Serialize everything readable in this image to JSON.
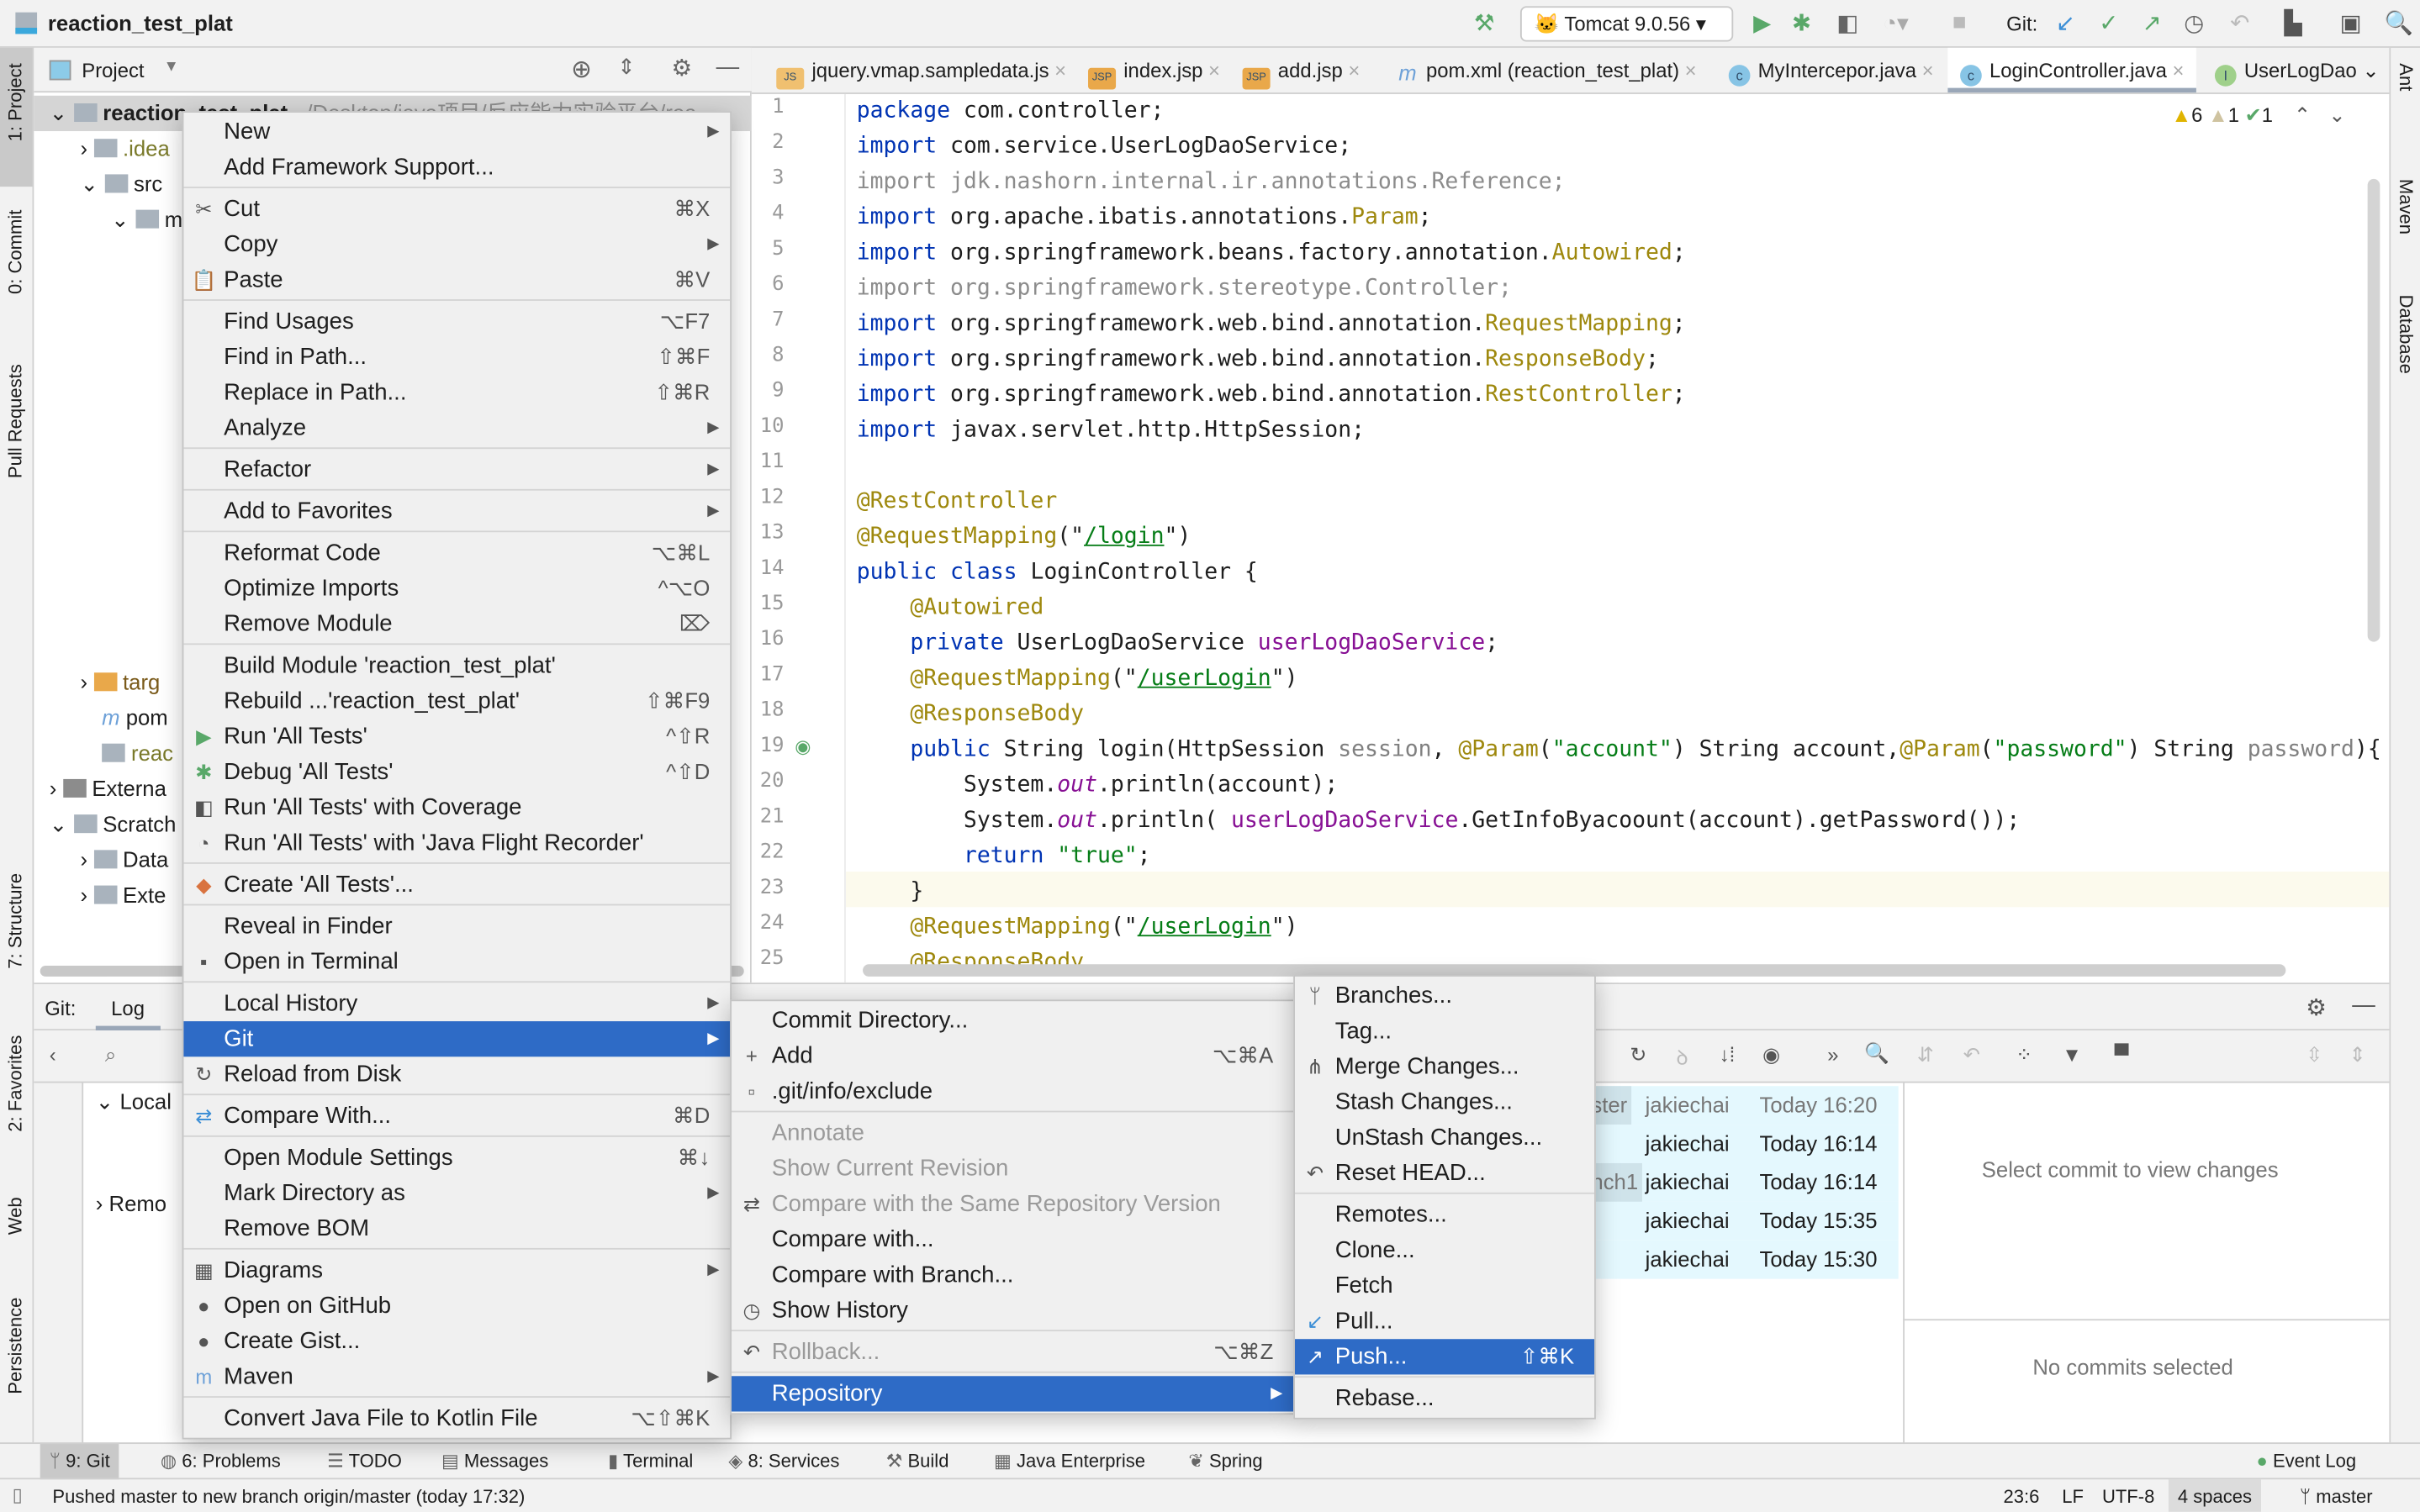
{
  "window": {
    "title": "reaction_test_plat"
  },
  "toolbar": {
    "run_config": "Tomcat 9.0.56",
    "git_label": "Git:"
  },
  "left_strip": [
    "1: Project",
    "0: Commit",
    "Pull Requests",
    "7: Structure",
    "2: Favorites",
    "Web",
    "Persistence"
  ],
  "right_strip": [
    "Ant",
    "Maven",
    "Database"
  ],
  "project": {
    "header": "Project",
    "root": "reaction_test_plat",
    "root_path": "~/Desktop/java项目/反应能力实验平台/rea",
    "tree": [
      ".idea",
      "src",
      "m",
      "targ",
      "pom",
      "reac",
      "Externa",
      "Scratch",
      "Data",
      "Exte"
    ]
  },
  "tabs": [
    {
      "label": "jquery.vmap.sampledata.js",
      "icon": "js"
    },
    {
      "label": "index.jsp",
      "icon": "jsp"
    },
    {
      "label": "add.jsp",
      "icon": "jsp"
    },
    {
      "label": "pom.xml (reaction_test_plat)",
      "icon": "m"
    },
    {
      "label": "MyIntercepor.java",
      "icon": "C"
    },
    {
      "label": "LoginController.java",
      "icon": "C",
      "active": true
    },
    {
      "label": "UserLogDao",
      "icon": "I"
    }
  ],
  "inspections": {
    "warnings": "6",
    "weak_warnings": "1",
    "ok": "1"
  },
  "code": [
    [
      [
        "package ",
        "k"
      ],
      [
        "com.controller;",
        ""
      ]
    ],
    [
      [
        "import ",
        "k"
      ],
      [
        "com.service.UserLogDaoService;",
        ""
      ]
    ],
    [
      [
        "import jdk.nashorn.internal.ir.annotations.Reference;",
        "g"
      ]
    ],
    [
      [
        "import ",
        "k"
      ],
      [
        "org.apache.ibatis.annotations.",
        ""
      ],
      [
        "Param",
        "a"
      ],
      [
        ";",
        ""
      ]
    ],
    [
      [
        "import ",
        "k"
      ],
      [
        "org.springframework.beans.factory.annotation.",
        ""
      ],
      [
        "Autowired",
        "a"
      ],
      [
        ";",
        ""
      ]
    ],
    [
      [
        "import org.springframework.stereotype.Controller;",
        "g"
      ]
    ],
    [
      [
        "import ",
        "k"
      ],
      [
        "org.springframework.web.bind.annotation.",
        ""
      ],
      [
        "RequestMapping",
        "a"
      ],
      [
        ";",
        ""
      ]
    ],
    [
      [
        "import ",
        "k"
      ],
      [
        "org.springframework.web.bind.annotation.",
        ""
      ],
      [
        "ResponseBody",
        "a"
      ],
      [
        ";",
        ""
      ]
    ],
    [
      [
        "import ",
        "k"
      ],
      [
        "org.springframework.web.bind.annotation.",
        ""
      ],
      [
        "RestController",
        "a"
      ],
      [
        ";",
        ""
      ]
    ],
    [
      [
        "import ",
        "k"
      ],
      [
        "javax.servlet.http.HttpSession;",
        ""
      ]
    ],
    [],
    [
      [
        "@RestController",
        "a"
      ]
    ],
    [
      [
        "@RequestMapping",
        "a"
      ],
      [
        "(\"",
        ""
      ],
      [
        "/login",
        "u"
      ],
      [
        "\")",
        ""
      ]
    ],
    [
      [
        "public class ",
        "k"
      ],
      [
        "LoginController {",
        ""
      ]
    ],
    [
      [
        "    ",
        ""
      ],
      [
        "@Autowired",
        "a"
      ]
    ],
    [
      [
        "    ",
        ""
      ],
      [
        "private ",
        "k"
      ],
      [
        "UserLogDaoService ",
        ""
      ],
      [
        "userLogDaoService",
        "f"
      ],
      [
        ";",
        ""
      ]
    ],
    [
      [
        "    ",
        ""
      ],
      [
        "@RequestMapping",
        "a"
      ],
      [
        "(\"",
        ""
      ],
      [
        "/userLogin",
        "u"
      ],
      [
        "\")",
        ""
      ]
    ],
    [
      [
        "    ",
        ""
      ],
      [
        "@ResponseBody",
        "a"
      ]
    ],
    [
      [
        "    ",
        ""
      ],
      [
        "public ",
        "k"
      ],
      [
        "String login(HttpSession ",
        ""
      ],
      [
        "session",
        "p"
      ],
      [
        ", ",
        ""
      ],
      [
        "@Param",
        "a"
      ],
      [
        "(",
        ""
      ],
      [
        "\"account\"",
        "s"
      ],
      [
        ") String account,",
        ""
      ],
      [
        "@Param",
        "a"
      ],
      [
        "(",
        ""
      ],
      [
        "\"password\"",
        "s"
      ],
      [
        ") String ",
        ""
      ],
      [
        "password",
        "p"
      ],
      [
        "){",
        ""
      ]
    ],
    [
      [
        "        System.",
        ""
      ],
      [
        "out",
        "i"
      ],
      [
        ".println(account);",
        ""
      ]
    ],
    [
      [
        "        System.",
        ""
      ],
      [
        "out",
        "i"
      ],
      [
        ".println( ",
        ""
      ],
      [
        "userLogDaoService",
        "f"
      ],
      [
        ".GetInfoByacoount(account).getPassword());",
        ""
      ]
    ],
    [
      [
        "        ",
        ""
      ],
      [
        "return ",
        "k"
      ],
      [
        "\"true\"",
        "s"
      ],
      [
        ";",
        ""
      ]
    ],
    [
      [
        "    }",
        ""
      ]
    ],
    [
      [
        "    ",
        ""
      ],
      [
        "@RequestMapping",
        "a"
      ],
      [
        "(\"",
        ""
      ],
      [
        "/userLogin",
        "u"
      ],
      [
        "\")",
        ""
      ]
    ],
    [
      [
        "    ",
        ""
      ],
      [
        "@ResponseBody",
        "a"
      ]
    ]
  ],
  "git_panel": {
    "title": "Git:",
    "tab": "Log",
    "tree": [
      "Local",
      "Remo"
    ],
    "commits": [
      {
        "ref": "ster",
        "author": "jakiechai",
        "date": "Today 16:20"
      },
      {
        "ref": "",
        "author": "jakiechai",
        "date": "Today 16:14"
      },
      {
        "ref": "nch1",
        "author": "jakiechai",
        "date": "Today 16:14"
      },
      {
        "ref": "",
        "author": "jakiechai",
        "date": "Today 15:35"
      },
      {
        "ref": "",
        "author": "jakiechai",
        "date": "Today 15:30"
      }
    ],
    "details_empty": "Select commit to view changes",
    "no_commits": "No commits selected"
  },
  "context_menu": [
    {
      "label": "New",
      "arrow": true
    },
    {
      "label": "Add Framework Support..."
    },
    {
      "sep": true
    },
    {
      "label": "Cut",
      "shortcut": "⌘X",
      "icon": "✂"
    },
    {
      "label": "Copy",
      "arrow": true
    },
    {
      "label": "Paste",
      "shortcut": "⌘V",
      "icon": "📋"
    },
    {
      "sep": true
    },
    {
      "label": "Find Usages",
      "shortcut": "⌥F7"
    },
    {
      "label": "Find in Path...",
      "shortcut": "⇧⌘F"
    },
    {
      "label": "Replace in Path...",
      "shortcut": "⇧⌘R"
    },
    {
      "label": "Analyze",
      "arrow": true
    },
    {
      "sep": true
    },
    {
      "label": "Refactor",
      "arrow": true
    },
    {
      "sep": true
    },
    {
      "label": "Add to Favorites",
      "arrow": true
    },
    {
      "sep": true
    },
    {
      "label": "Reformat Code",
      "shortcut": "⌥⌘L"
    },
    {
      "label": "Optimize Imports",
      "shortcut": "^⌥O"
    },
    {
      "label": "Remove Module",
      "shortcut": "⌦"
    },
    {
      "sep": true
    },
    {
      "label": "Build Module 'reaction_test_plat'"
    },
    {
      "label": "Rebuild ...'reaction_test_plat'",
      "shortcut": "⇧⌘F9"
    },
    {
      "label": "Run 'All Tests'",
      "shortcut": "^⇧R",
      "icon": "▶",
      "icon_color": "#59a869"
    },
    {
      "label": "Debug 'All Tests'",
      "shortcut": "^⇧D",
      "icon": "✱",
      "icon_color": "#59a869"
    },
    {
      "label": "Run 'All Tests' with Coverage",
      "icon": "◧"
    },
    {
      "label": "Run 'All Tests' with 'Java Flight Recorder'",
      "icon": "◔"
    },
    {
      "sep": true
    },
    {
      "label": "Create 'All Tests'...",
      "icon": "◆",
      "icon_color": "#d9733f"
    },
    {
      "sep": true
    },
    {
      "label": "Reveal in Finder"
    },
    {
      "label": "Open in Terminal",
      "icon": "▪"
    },
    {
      "sep": true
    },
    {
      "label": "Local History",
      "arrow": true
    },
    {
      "label": "Git",
      "arrow": true,
      "selected": true
    },
    {
      "label": "Reload from Disk",
      "icon": "↻"
    },
    {
      "sep": true
    },
    {
      "label": "Compare With...",
      "shortcut": "⌘D",
      "icon": "⇄",
      "icon_color": "#3d8fd6"
    },
    {
      "sep": true
    },
    {
      "label": "Open Module Settings",
      "shortcut": "⌘↓"
    },
    {
      "label": "Mark Directory as",
      "arrow": true
    },
    {
      "label": "Remove BOM"
    },
    {
      "sep": true
    },
    {
      "label": "Diagrams",
      "arrow": true,
      "icon": "▦"
    },
    {
      "label": "Open on GitHub",
      "icon": "●"
    },
    {
      "label": "Create Gist...",
      "icon": "●"
    },
    {
      "label": "Maven",
      "arrow": true,
      "icon": "m",
      "icon_color": "#6ea1d8"
    },
    {
      "sep": true
    },
    {
      "label": "Convert Java File to Kotlin File",
      "shortcut": "⌥⇧⌘K"
    }
  ],
  "git_menu": [
    {
      "label": "Commit Directory..."
    },
    {
      "label": "Add",
      "shortcut": "⌥⌘A",
      "icon": "+"
    },
    {
      "label": ".git/info/exclude",
      "icon": "▫"
    },
    {
      "sep": true
    },
    {
      "label": "Annotate",
      "disabled": true
    },
    {
      "label": "Show Current Revision",
      "disabled": true
    },
    {
      "label": "Compare with the Same Repository Version",
      "disabled": true,
      "icon": "⇄"
    },
    {
      "label": "Compare with..."
    },
    {
      "label": "Compare with Branch..."
    },
    {
      "label": "Show History",
      "icon": "◷"
    },
    {
      "sep": true
    },
    {
      "label": "Rollback...",
      "shortcut": "⌥⌘Z",
      "disabled": true,
      "icon": "↶"
    },
    {
      "sep": true
    },
    {
      "label": "Repository",
      "arrow": true,
      "selected": true
    }
  ],
  "repository_menu": [
    {
      "label": "Branches...",
      "icon": "ᛘ"
    },
    {
      "label": "Tag..."
    },
    {
      "label": "Merge Changes...",
      "icon": "⋔"
    },
    {
      "label": "Stash Changes..."
    },
    {
      "label": "UnStash Changes..."
    },
    {
      "label": "Reset HEAD...",
      "icon": "↶"
    },
    {
      "sep": true
    },
    {
      "label": "Remotes..."
    },
    {
      "label": "Clone..."
    },
    {
      "label": "Fetch"
    },
    {
      "label": "Pull...",
      "icon": "↙",
      "icon_color": "#3d8fd6"
    },
    {
      "label": "Push...",
      "shortcut": "⇧⌘K",
      "icon": "↗",
      "icon_color": "#59a869",
      "selected": true
    },
    {
      "sep": true
    },
    {
      "label": "Rebase..."
    }
  ],
  "tool_windows": [
    "9: Git",
    "6: Problems",
    "TODO",
    "Messages",
    "Terminal",
    "8: Services",
    "Build",
    "Java Enterprise",
    "Spring"
  ],
  "event_log": "Event Log",
  "status": {
    "message": "Pushed master to new branch origin/master (today 17:32)",
    "position": "23:6",
    "line_sep": "LF",
    "encoding": "UTF-8",
    "indent": "4 spaces",
    "branch": "master"
  },
  "colors": {
    "selection": "#2e6bc6",
    "log_row": "#e4f8fe",
    "accent_green": "#59a869"
  }
}
